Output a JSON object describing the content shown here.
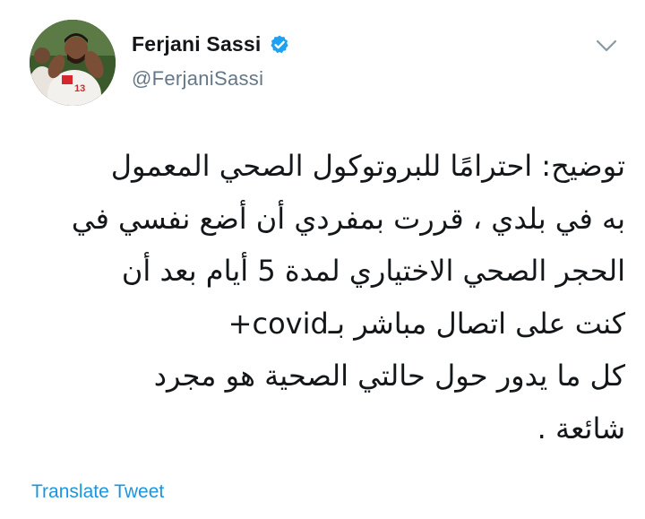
{
  "tweet": {
    "author": {
      "display_name": "Ferjani Sassi",
      "handle": "@FerjaniSassi",
      "verified": true,
      "avatar_icon": "player-photo-avatar",
      "jersey_number": "13"
    },
    "body_lines": [
      "توضيح: احترامًا للبروتوكول الصحي المعمول",
      "به في بلدي ، قررت بمفردي أن أضع نفسي في",
      "الحجر الصحي الاختياري لمدة 5 أيام بعد أن",
      "كنت على اتصال مباشر بـcovid+",
      "كل ما يدور حول حالتي الصحية هو مجرد",
      "شائعة ."
    ],
    "translate_label": "Translate Tweet",
    "menu_icon": "chevron-down-icon"
  },
  "colors": {
    "text_primary": "#14171a",
    "text_secondary": "#657786",
    "link": "#1b95e0",
    "verified_badge": "#1da1f2"
  }
}
